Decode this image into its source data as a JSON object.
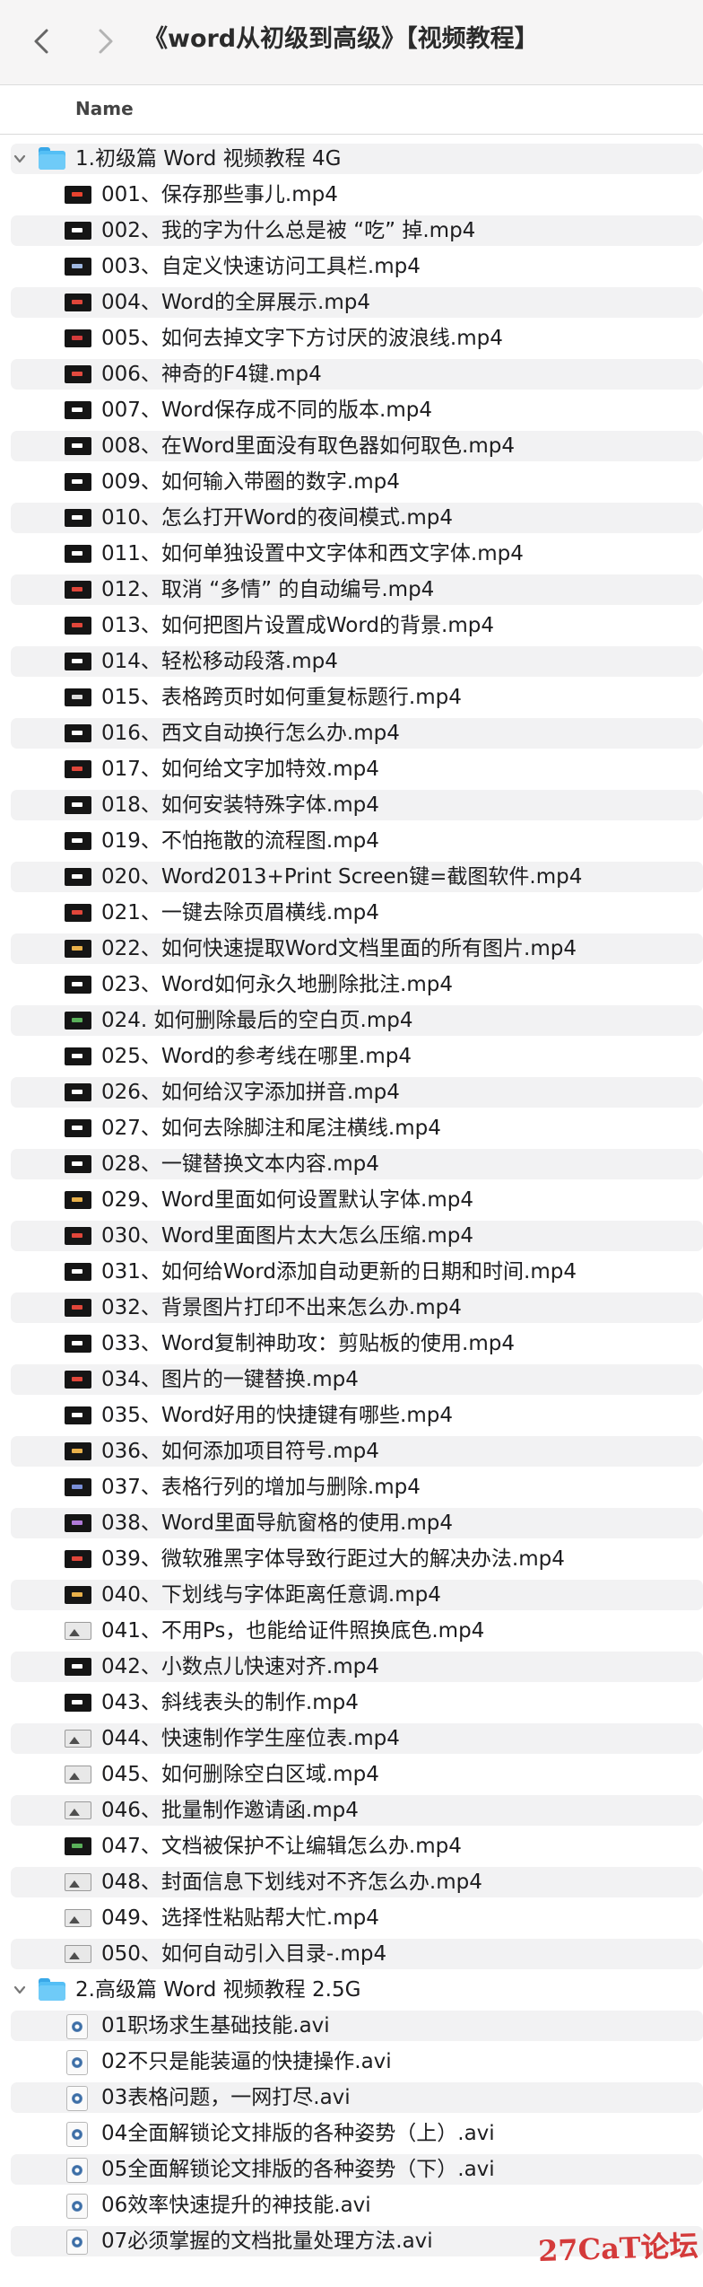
{
  "window": {
    "title": "《word从初级到高级》【视频教程】",
    "back_icon": "chevron-left-icon",
    "forward_icon": "chevron-right-icon"
  },
  "columns": {
    "name": "Name"
  },
  "folders": [
    {
      "name": "1.初级篇 Word 视频教程 4G",
      "expanded": true,
      "files": [
        {
          "label": "001、保存那些事儿.mp4",
          "thumb": "dark",
          "color": "#e8432f"
        },
        {
          "label": "002、我的字为什么总是被 “吃” 掉.mp4",
          "thumb": "dark",
          "color": "#ffffff"
        },
        {
          "label": "003、自定义快速访问工具栏.mp4",
          "thumb": "dark",
          "color": "#9fb7e0"
        },
        {
          "label": "004、Word的全屏展示.mp4",
          "thumb": "dark",
          "color": "#e0463a"
        },
        {
          "label": "005、如何去掉文字下方讨厌的波浪线.mp4",
          "thumb": "dark",
          "color": "#d23b3b"
        },
        {
          "label": "006、神奇的F4键.mp4",
          "thumb": "dark",
          "color": "#e24a3f"
        },
        {
          "label": "007、Word保存成不同的版本.mp4",
          "thumb": "dark",
          "color": "#ffffff"
        },
        {
          "label": "008、在Word里面没有取色器如何取色.mp4",
          "thumb": "dark",
          "color": "#ffffff"
        },
        {
          "label": "009、如何输入带圈的数字.mp4",
          "thumb": "dark",
          "color": "#ffffff"
        },
        {
          "label": "010、怎么打开Word的夜间模式.mp4",
          "thumb": "dark",
          "color": "#ffffff"
        },
        {
          "label": "011、如何单独设置中文字体和西文字体.mp4",
          "thumb": "dark",
          "color": "#ffffff"
        },
        {
          "label": "012、取消 “多情” 的自动编号.mp4",
          "thumb": "dark",
          "color": "#e0463a"
        },
        {
          "label": "013、如何把图片设置成Word的背景.mp4",
          "thumb": "dark",
          "color": "#e0463a"
        },
        {
          "label": "014、轻松移动段落.mp4",
          "thumb": "dark",
          "color": "#ffffff"
        },
        {
          "label": "015、表格跨页时如何重复标题行.mp4",
          "thumb": "dark",
          "color": "#dcdcdc"
        },
        {
          "label": "016、西文自动换行怎么办.mp4",
          "thumb": "dark",
          "color": "#ffffff"
        },
        {
          "label": "017、如何给文字加特效.mp4",
          "thumb": "dark",
          "color": "#e0463a"
        },
        {
          "label": "018、如何安装特殊字体.mp4",
          "thumb": "dark",
          "color": "#ffffff"
        },
        {
          "label": "019、不怕拖散的流程图.mp4",
          "thumb": "dark",
          "color": "#ffffff"
        },
        {
          "label": "020、Word2013+Print Screen键=截图软件.mp4",
          "thumb": "dark",
          "color": "#ffffff"
        },
        {
          "label": "021、一键去除页眉横线.mp4",
          "thumb": "dark",
          "color": "#e0463a"
        },
        {
          "label": "022、如何快速提取Word文档里面的所有图片.mp4",
          "thumb": "dark",
          "color": "#e8b04a"
        },
        {
          "label": "023、Word如何永久地删除批注.mp4",
          "thumb": "dark",
          "color": "#ffffff"
        },
        {
          "label": "024. 如何删除最后的空白页.mp4",
          "thumb": "dark",
          "color": "#5ab05a"
        },
        {
          "label": "025、Word的参考线在哪里.mp4",
          "thumb": "dark",
          "color": "#ffffff"
        },
        {
          "label": "026、如何给汉字添加拼音.mp4",
          "thumb": "dark",
          "color": "#ffffff"
        },
        {
          "label": "027、如何去除脚注和尾注横线.mp4",
          "thumb": "dark",
          "color": "#ffffff"
        },
        {
          "label": "028、一键替换文本内容.mp4",
          "thumb": "dark",
          "color": "#ffffff"
        },
        {
          "label": "029、Word里面如何设置默认字体.mp4",
          "thumb": "dark",
          "color": "#e8b04a"
        },
        {
          "label": "030、Word里面图片太大怎么压缩.mp4",
          "thumb": "dark",
          "color": "#e0463a"
        },
        {
          "label": "031、如何给Word添加自动更新的日期和时间.mp4",
          "thumb": "dark",
          "color": "#ffffff"
        },
        {
          "label": "032、背景图片打印不出来怎么办.mp4",
          "thumb": "dark",
          "color": "#e0463a"
        },
        {
          "label": "033、Word复制神助攻：剪贴板的使用.mp4",
          "thumb": "dark",
          "color": "#ffffff"
        },
        {
          "label": "034、图片的一键替换.mp4",
          "thumb": "dark",
          "color": "#e0463a"
        },
        {
          "label": "035、Word好用的快捷键有哪些.mp4",
          "thumb": "dark",
          "color": "#ffffff"
        },
        {
          "label": "036、如何添加项目符号.mp4",
          "thumb": "dark",
          "color": "#e8b04a"
        },
        {
          "label": "037、表格行列的增加与删除.mp4",
          "thumb": "dark",
          "color": "#7a8fd8"
        },
        {
          "label": "038、Word里面导航窗格的使用.mp4",
          "thumb": "dark",
          "color": "#b07ad8"
        },
        {
          "label": "039、微软雅黑字体导致行距过大的解决办法.mp4",
          "thumb": "dark",
          "color": "#e0463a"
        },
        {
          "label": "040、下划线与字体距离任意调.mp4",
          "thumb": "dark",
          "color": "#e8b04a"
        },
        {
          "label": "041、不用Ps，也能给证件照换底色.mp4",
          "thumb": "light",
          "color": "#4f4f4f"
        },
        {
          "label": "042、小数点儿快速对齐.mp4",
          "thumb": "dark",
          "color": "#ffffff"
        },
        {
          "label": "043、斜线表头的制作.mp4",
          "thumb": "dark",
          "color": "#ffffff"
        },
        {
          "label": "044、快速制作学生座位表.mp4",
          "thumb": "light",
          "color": "#4f4f4f"
        },
        {
          "label": "045、如何删除空白区域.mp4",
          "thumb": "light",
          "color": "#4f4f4f"
        },
        {
          "label": "046、批量制作邀请函.mp4",
          "thumb": "light",
          "color": "#4f4f4f"
        },
        {
          "label": "047、文档被保护不让编辑怎么办.mp4",
          "thumb": "dark",
          "color": "#5ab05a"
        },
        {
          "label": "048、封面信息下划线对不齐怎么办.mp4",
          "thumb": "light",
          "color": "#4f4f4f"
        },
        {
          "label": "049、选择性粘贴帮大忙.mp4",
          "thumb": "light",
          "color": "#4f4f4f"
        },
        {
          "label": "050、如何自动引入目录-.mp4",
          "thumb": "light",
          "color": "#4f4f4f"
        }
      ]
    },
    {
      "name": "2.高级篇 Word 视频教程 2.5G",
      "expanded": true,
      "files": [
        {
          "label": "01职场求生基础技能.avi",
          "thumb": "avi"
        },
        {
          "label": "02不只是能装逼的快捷操作.avi",
          "thumb": "avi"
        },
        {
          "label": "03表格问题，一网打尽.avi",
          "thumb": "avi"
        },
        {
          "label": "04全面解锁论文排版的各种姿势（上）.avi",
          "thumb": "avi"
        },
        {
          "label": "05全面解锁论文排版的各种姿势（下）.avi",
          "thumb": "avi"
        },
        {
          "label": "06效率快速提升的神技能.avi",
          "thumb": "avi"
        },
        {
          "label": "07必须掌握的文档批量处理方法.avi",
          "thumb": "avi"
        }
      ]
    }
  ],
  "watermark": "27CaT论坛"
}
